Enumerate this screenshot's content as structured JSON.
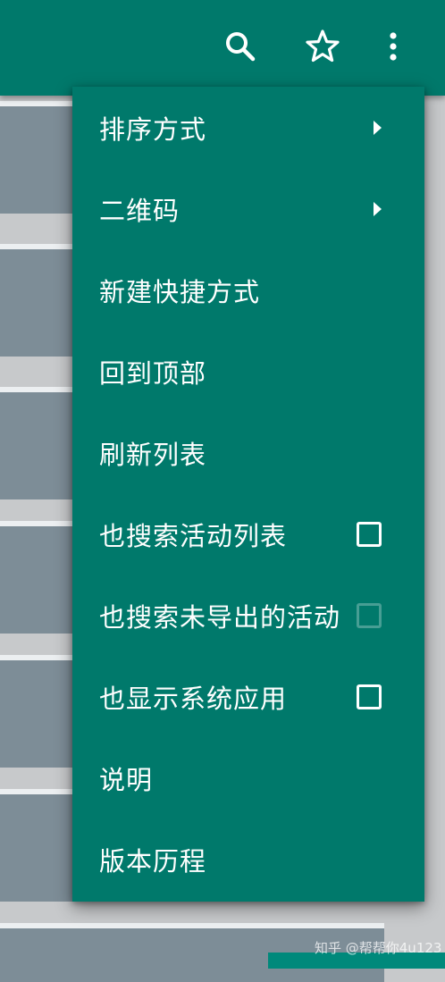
{
  "colors": {
    "primary": "#00796b",
    "background_card": "#7d8d97",
    "text": "#ffffff"
  },
  "toolbar": {
    "icons": [
      "search-icon",
      "star-icon",
      "more-vert-icon"
    ]
  },
  "menu": {
    "items": [
      {
        "label": "排序方式",
        "has_submenu": true
      },
      {
        "label": "二维码",
        "has_submenu": true
      },
      {
        "label": "新建快捷方式"
      },
      {
        "label": "回到顶部"
      },
      {
        "label": "刷新列表"
      },
      {
        "label": "也搜索活动列表",
        "checkbox": true,
        "checked": false,
        "enabled": true
      },
      {
        "label": "也搜索未导出的活动",
        "checkbox": true,
        "checked": false,
        "enabled": false
      },
      {
        "label": "也显示系统应用",
        "checkbox": true,
        "checked": false,
        "enabled": true
      },
      {
        "label": "说明"
      },
      {
        "label": "版本历程"
      }
    ]
  },
  "watermark": "知乎 @帮帮你4u123"
}
